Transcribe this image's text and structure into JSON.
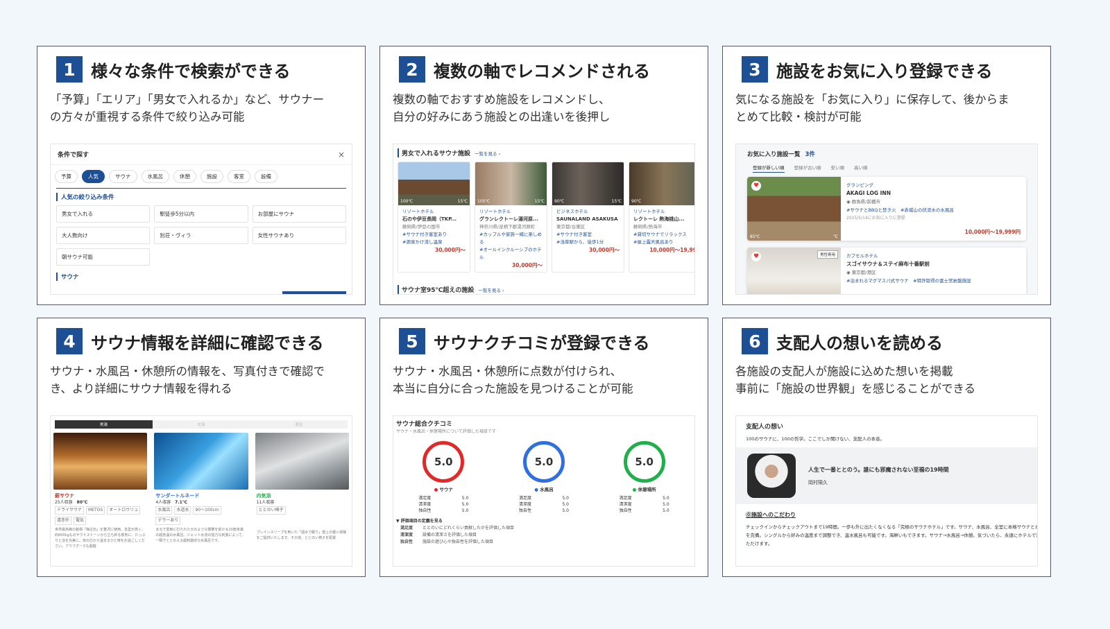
{
  "colors": {
    "accent": "#1d4f95",
    "price": "#c0392b"
  },
  "cards": [
    {
      "num": "1",
      "title": "様々な条件で検索ができる",
      "desc1": "「予算」「エリア」「男女で入れるか」など、サウナー",
      "desc2": "の方々が重視する条件で絞り込み可能"
    },
    {
      "num": "2",
      "title": "複数の軸でレコメンドされる",
      "desc1": "複数の軸でおすすめ施設をレコメンドし、",
      "desc2": "自分の好みにあう施設との出逢いを後押し"
    },
    {
      "num": "3",
      "title": "施設をお気に入り登録できる",
      "desc1": "気になる施設を「お気に入り」に保存して、後からま",
      "desc2": "とめて比較・検討が可能"
    },
    {
      "num": "4",
      "title": "サウナ情報を詳細に確認できる",
      "desc1": "サウナ・水風呂・休憩所の情報を、写真付きで確認で",
      "desc2": "き、より詳細にサウナ情報を得れる"
    },
    {
      "num": "5",
      "title": "サウナクチコミが登録できる",
      "desc1": "サウナ・水風呂・休憩所に点数が付けられ、",
      "desc2": "本当に自分に合った施設を見つけることが可能"
    },
    {
      "num": "6",
      "title": "支配人の想いを読める",
      "desc1": "各施設の支配人が施設に込めた想いを掲載",
      "desc2": "事前に「施設の世界観」を感じることができる"
    }
  ],
  "s1": {
    "header": "条件で探す",
    "close": "×",
    "tabs": [
      "予算",
      "人気",
      "サウナ",
      "水風呂",
      "休憩",
      "施設",
      "客室",
      "設備"
    ],
    "section": "人気の絞り込み条件",
    "chips": [
      "男女で入れる",
      "駅徒歩5分以内",
      "お部屋にサウナ",
      "大人数向け",
      "別荘・ヴィラ",
      "女性サウナあり",
      "朝サウナ可能"
    ],
    "section2": "サウナ"
  },
  "s2": {
    "header": "男女で入れるサウナ施設",
    "more": "一覧を見る ›",
    "footer": "サウナ室95℃超えの施設",
    "footer_more": "一覧を見る ›",
    "hotels": [
      {
        "temp": "100℃",
        "water": "15℃",
        "cat": "リゾートホテル",
        "name": "石のや伊豆長岡（TKP...",
        "loc": "静岡県/伊豆の国市",
        "t1": "#サウナ付き客室あり",
        "t2": "#源泉かけ流し温泉",
        "price": "30,000円～"
      },
      {
        "temp": "105℃",
        "water": "15℃",
        "cat": "リゾートホテル",
        "name": "グランレクトーレ湯河原...",
        "loc": "神奈川県/足柄下郡湯河原町",
        "t1": "#カップルや家族一緒に楽しめる",
        "t2": "#オールインクルーシブのホテル",
        "price": "30,000円～"
      },
      {
        "temp": "90℃",
        "water": "15℃",
        "cat": "ビジネスホテル",
        "name": "SAUNALAND ASAKUSA",
        "loc": "東京都/台東区",
        "t1": "#サウナ付き客室",
        "t2": "#浅草駅から、徒歩1分",
        "price": "30,000円～"
      },
      {
        "temp": "90℃",
        "water": "",
        "cat": "リゾートホテル",
        "name": "レクトーレ 熱海桃山...",
        "loc": "静岡県/熱海市",
        "t1": "#貸切サウナでリラックス",
        "t2": "#屋上露天風呂あり",
        "price": "10,000円～19,99"
      }
    ]
  },
  "s3": {
    "header": "お気に入り施設一覧",
    "count": "3件",
    "sorts": [
      "登録が新しい順",
      "登録が古い順",
      "安い順",
      "高い順"
    ],
    "f1": {
      "cat": "グランピング",
      "name": "AKAGI LOG INN",
      "loc": "群馬県/前橋市",
      "tags": "#サウナとBBQと焚き火　#赤城山の伏流水の水風呂",
      "date": "2025/5/14にお気に入りに登録",
      "temp": "85℃",
      "water": "℃",
      "price": "10,000円～19,999円"
    },
    "f2": {
      "badge": "男性専用",
      "cat": "カプセルホテル",
      "name": "スゴイサウナ＆ステイ麻布十番駅前",
      "loc": "東京都/港区",
      "tags": "#泊まれるマグマスパ式サウナ　#特許取得の富士宮岩盤施設"
    }
  },
  "s4": {
    "tabs": [
      "男湯",
      "女湯",
      "混浴"
    ],
    "items": [
      {
        "name": "薪サウナ",
        "cap": "25人収容",
        "temp": "80℃",
        "tags": [
          "ドライサウナ",
          "METOS",
          "オートロウリュ",
          "遠赤外",
          "電気"
        ],
        "text": "世界最高峰の銘柄「梅古石」を贅沢に使用。息型が高く、約600kgものサウナストーンから立ち昇る蒸気に、たっぷりと浴を充実に。体の芯から温まるひと時をお過ごしください。アウフグースも開催"
      },
      {
        "name": "サンダートルネード",
        "cap": "4人収容",
        "temp": "7.1℃",
        "tags": [
          "水風呂",
          "水道水",
          "90～100cm",
          "デラーあり"
        ],
        "text": "まるで雷雨に打たれたかのような衝撃を受ける10度未満の超低温の水風呂。ジェット水流の強力な刺激によって、一瞬でととのえる超刺激的な水風呂です。"
      },
      {
        "name": "内気浴",
        "cap": "11人収容",
        "temp": "",
        "tags": [
          "ととのい椅子"
        ],
        "text": "プレインスリープを用いた「寝水で眠り」極上の整い体験をご提供いたします。その他、ととのい椅子を配置"
      }
    ]
  },
  "s5": {
    "title": "サウナ総合クチコミ",
    "sub": "サウナ・水風呂・休憩場所について評価した項目です",
    "scores": [
      {
        "value": "5.0",
        "label": "サウナ",
        "color": "#e02a2a",
        "rows": [
          [
            "満足度",
            "5.0"
          ],
          [
            "清潔度",
            "5.0"
          ],
          [
            "独自性",
            "5.0"
          ]
        ]
      },
      {
        "value": "5.0",
        "label": "水風呂",
        "color": "#2f6fe0",
        "rows": [
          [
            "満足度",
            "5.0"
          ],
          [
            "清潔度",
            "5.0"
          ],
          [
            "独自性",
            "5.0"
          ]
        ]
      },
      {
        "value": "5.0",
        "label": "休憩場所",
        "color": "#20b04b",
        "rows": [
          [
            "満足度",
            "5.0"
          ],
          [
            "清潔度",
            "5.0"
          ],
          [
            "独自性",
            "5.0"
          ]
        ]
      }
    ],
    "def_title": "▼ 評価項目の定義を見る",
    "defs": [
      [
        "満足度",
        "ととのいにどれくらい貢献したかを評価した項目"
      ],
      [
        "清潔度",
        "設備の清潔さを評価した項目"
      ],
      [
        "独自性",
        "施設の遊び心や独自性を評価した項目"
      ]
    ]
  },
  "s6": {
    "title": "支配人の想い",
    "sub": "100のサウナに、100の哲学。ここでしか聞けない、支配人の本音。",
    "msg": "人生で一番ととのう。誰にも邪魔されない至福の19時間",
    "author": "岡村陽久",
    "kodawari": "⓪施設へのこだわり",
    "body": "チェックインからチェックアウトまで19時間。一歩も外に出たくなくなる「究極のサウナホテル」です。サウナ、水風呂、全室に本格サウナと水風呂を完備。シングルから好みの温度まで調整でき、温水風呂も可能です。海鮮いもできます。サウナ→水風呂→休憩。気づいたら、永遠にホテルで満喫いただけます。"
  }
}
